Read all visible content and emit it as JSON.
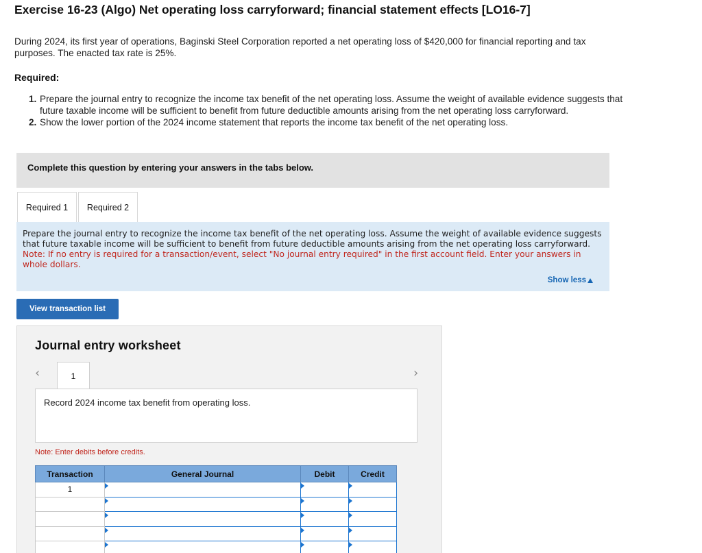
{
  "title": "Exercise 16-23 (Algo) Net operating loss carryforward; financial statement effects [LO16-7]",
  "intro": "During 2024, its first year of operations, Baginski Steel Corporation reported a net operating loss of $420,000 for financial reporting and tax purposes. The enacted tax rate is 25%.",
  "required_heading": "Required:",
  "requirements": [
    {
      "num": "1.",
      "text": "Prepare the journal entry to recognize the income tax benefit of the net operating loss. Assume the weight of available evidence suggests that future taxable income will be sufficient to benefit from future deductible amounts arising from the net operating loss carryforward."
    },
    {
      "num": "2.",
      "text": "Show the lower portion of the 2024 income statement that reports the income tax benefit of the net operating loss."
    }
  ],
  "complete_prompt": "Complete this question by entering your answers in the tabs below.",
  "tabs": [
    {
      "label": "Required 1"
    },
    {
      "label": "Required 2"
    }
  ],
  "instructions": {
    "main": "Prepare the journal entry to recognize the income tax benefit of the net operating loss. Assume the weight of available evidence suggests that future taxable income will be sufficient to benefit from future deductible amounts arising from the net operating loss carryforward.",
    "note": "Note: If no entry is required for a transaction/event, select \"No journal entry required\" in the first account field. Enter your answers in whole dollars.",
    "show_less": "Show less"
  },
  "view_transaction_list": "View transaction list",
  "worksheet": {
    "title": "Journal entry worksheet",
    "entry_number": "1",
    "description": "Record 2024 income tax benefit from operating loss.",
    "note": "Note: Enter debits before credits.",
    "columns": [
      "Transaction",
      "General Journal",
      "Debit",
      "Credit"
    ],
    "rows": [
      {
        "transaction": "1"
      },
      {
        "transaction": ""
      },
      {
        "transaction": ""
      },
      {
        "transaction": ""
      },
      {
        "transaction": ""
      }
    ]
  },
  "icons": {
    "prev": "chevron-left-icon",
    "next": "chevron-right-icon",
    "show_less": "triangle-up-icon"
  },
  "colors": {
    "info_bg": "#dceaf6",
    "note_red": "#c0271e",
    "button_blue": "#2a6cb5",
    "table_header": "#7aa9dc",
    "link_blue": "#1565b3"
  }
}
